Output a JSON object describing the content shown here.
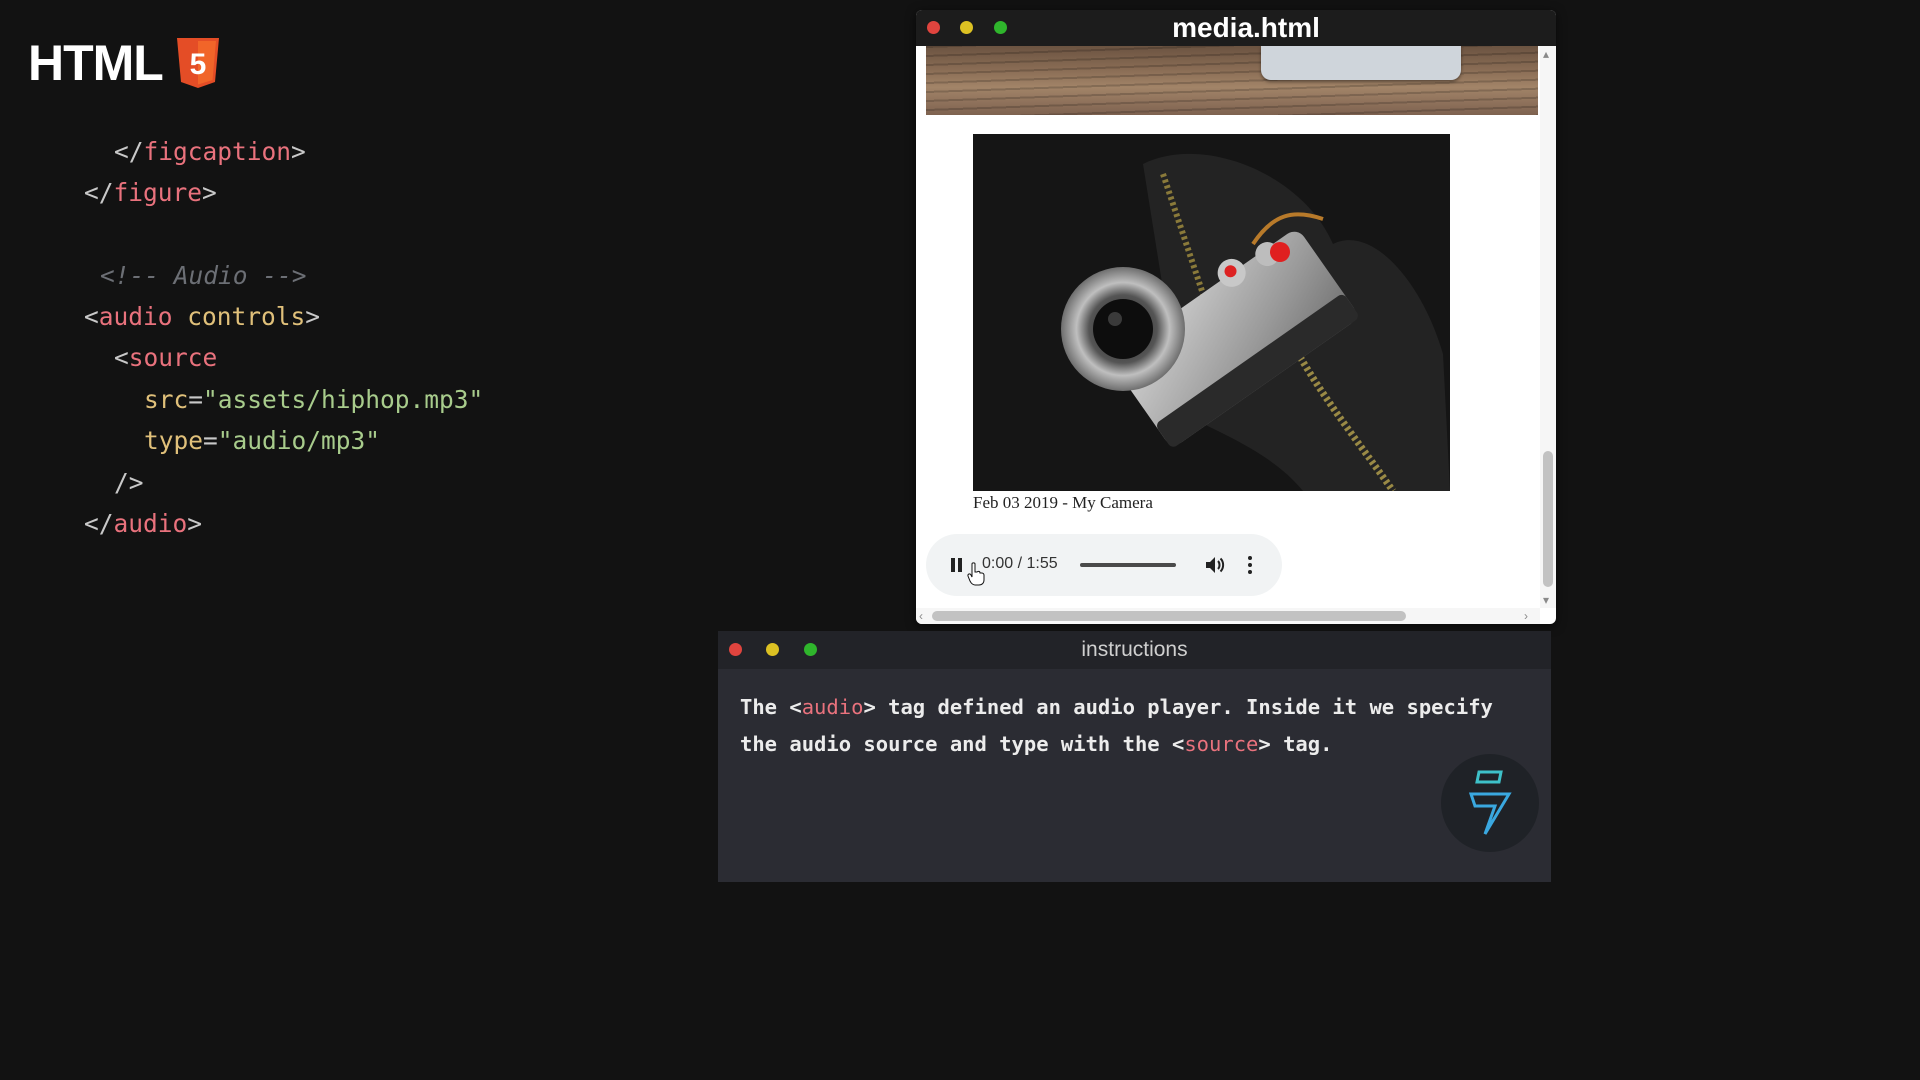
{
  "logo": {
    "text": "HTML",
    "badge_icon": "html5-shield-icon",
    "badge_digit": "5",
    "accent": "#e44d26"
  },
  "code": {
    "lines": [
      {
        "parts": [
          [
            "punc",
            "</"
          ],
          [
            "tag",
            "figcaption"
          ],
          [
            "punc",
            ">"
          ]
        ]
      },
      {
        "parts": [
          [
            "punc",
            "</"
          ],
          [
            "tag",
            "figure"
          ],
          [
            "punc",
            ">"
          ]
        ]
      },
      {
        "parts": [
          [
            "cmt",
            "<!-- Audio -->"
          ]
        ]
      },
      {
        "parts": [
          [
            "punc",
            "<"
          ],
          [
            "tag",
            "audio "
          ],
          [
            "attr",
            "controls"
          ],
          [
            "punc",
            ">"
          ]
        ]
      },
      {
        "parts": [
          [
            "punc",
            "<"
          ],
          [
            "tag",
            "source"
          ]
        ]
      },
      {
        "parts": [
          [
            "attr",
            "src"
          ],
          [
            "punc",
            "="
          ],
          [
            "str",
            "\"assets/hiphop.mp3\""
          ]
        ]
      },
      {
        "parts": [
          [
            "attr",
            "type"
          ],
          [
            "punc",
            "="
          ],
          [
            "str",
            "\"audio/mp3\""
          ]
        ]
      },
      {
        "parts": [
          [
            "punc",
            "/>"
          ]
        ]
      },
      {
        "parts": [
          [
            "punc",
            "</"
          ],
          [
            "tag",
            "audio"
          ],
          [
            "punc",
            ">"
          ]
        ]
      }
    ]
  },
  "browser": {
    "title": "media.html",
    "caption": "Feb 03 2019 - My Camera",
    "player": {
      "time": "0:00 / 1:55",
      "state": "playing",
      "icons": [
        "pause-icon",
        "volume-icon",
        "more-options-icon"
      ]
    }
  },
  "instructions": {
    "title": "instructions",
    "text_parts": [
      [
        "plain",
        "The <"
      ],
      [
        "tag",
        "audio"
      ],
      [
        "plain",
        "> tag defined an audio player. Inside it we specify the audio source and type with the <"
      ],
      [
        "tag",
        "source"
      ],
      [
        "plain",
        "> tag."
      ]
    ]
  },
  "colors": {
    "tag": "#e9727d",
    "attr": "#e0c07a",
    "string": "#a8cc8c",
    "comment": "#6c6f75"
  }
}
